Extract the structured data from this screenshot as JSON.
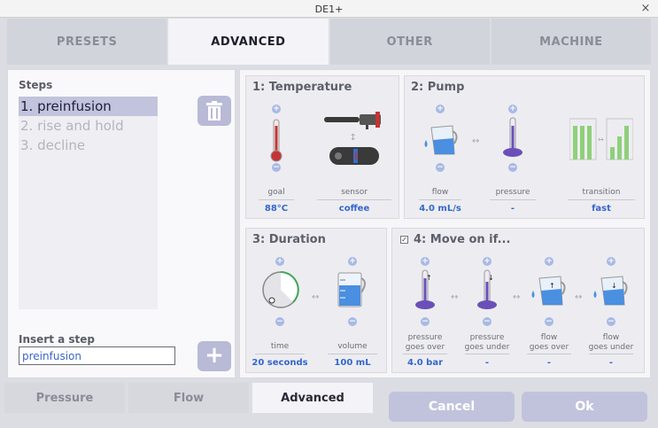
{
  "window": {
    "title": "DE1+",
    "close_glyph": "×"
  },
  "top_tabs": [
    "PRESETS",
    "ADVANCED",
    "OTHER",
    "MACHINE"
  ],
  "steps": {
    "heading": "Steps",
    "items": [
      "1. preinfusion",
      "2. rise and hold",
      "3. decline"
    ]
  },
  "insert": {
    "heading": "Insert a step",
    "value": "preinfusion",
    "add_glyph": "+"
  },
  "temperature": {
    "title": "1: Temperature",
    "goal": {
      "label": "goal",
      "value": "88°C"
    },
    "sensor": {
      "label": "sensor",
      "value": "coffee"
    }
  },
  "pump": {
    "title": "2: Pump",
    "flow": {
      "label": "flow",
      "value": "4.0 mL/s"
    },
    "pressure": {
      "label": "pressure",
      "value": "-"
    },
    "transition": {
      "label": "transition",
      "value": "fast"
    }
  },
  "duration": {
    "title": "3: Duration",
    "time": {
      "label": "time",
      "value": "20 seconds"
    },
    "volume": {
      "label": "volume",
      "value": "100 mL"
    }
  },
  "move_on": {
    "title": "4: Move on if...",
    "checked": true,
    "pressure_over": {
      "label_1": "pressure",
      "label_2": "goes over",
      "value": "4.0 bar"
    },
    "pressure_under": {
      "label_1": "pressure",
      "label_2": "goes under",
      "value": "-"
    },
    "flow_over": {
      "label_1": "flow",
      "label_2": "goes over",
      "value": "-"
    },
    "flow_under": {
      "label_1": "flow",
      "label_2": "goes under",
      "value": "-"
    }
  },
  "bottom_tabs": [
    "Pressure",
    "Flow",
    "Advanced"
  ],
  "buttons": {
    "cancel": "Cancel",
    "ok": "Ok"
  },
  "glyphs": {
    "plus": "+",
    "minus": "−",
    "arrow": "↔",
    "check": "✓"
  },
  "colors": {
    "accent_blue": "#3467cc",
    "liquid_blue": "#4a8fe0",
    "purple": "#6b4fb8",
    "thermo_red": "#c43434",
    "green": "#8fd07a"
  }
}
